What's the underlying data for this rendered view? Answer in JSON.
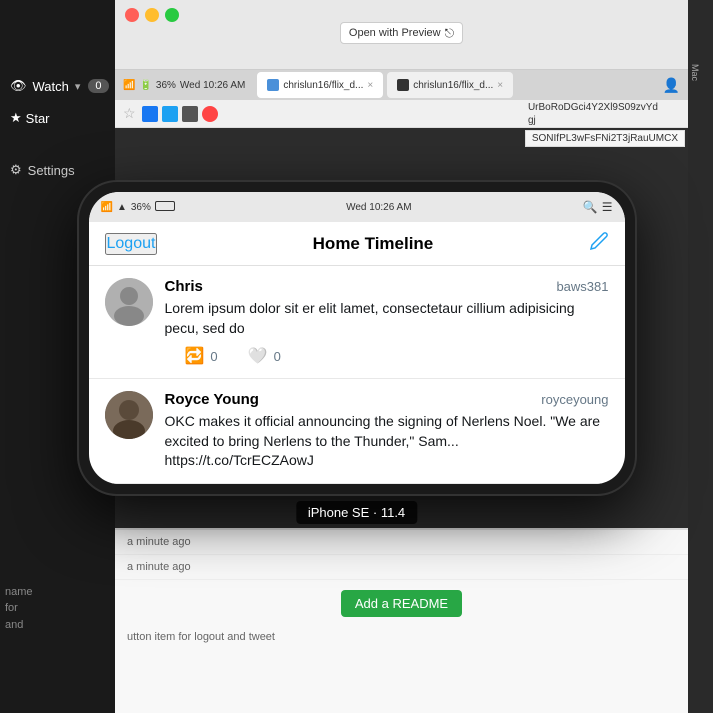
{
  "topBar": {
    "buttons": [
      "red",
      "yellow",
      "green"
    ],
    "openPreview": "Open with Preview"
  },
  "statusBar": {
    "time": "Wed 10:26 AM",
    "batteryPercent": "36%",
    "wifi": "WiFi"
  },
  "tabs": [
    {
      "label": "chrislun16/flix_d...",
      "active": true
    },
    {
      "label": "chrislun16/flix_d...",
      "active": false
    }
  ],
  "app": {
    "header": {
      "logout": "Logout",
      "title": "Home Timeline",
      "editIcon": "✏"
    },
    "tweets": [
      {
        "name": "Chris",
        "handle": "baws381",
        "text": "Lorem ipsum dolor sit er elit lamet, consectetaur cillium adipisicing pecu, sed do",
        "retweets": "0",
        "likes": "0",
        "hasAvatar": false
      },
      {
        "name": "Royce Young",
        "handle": "royceyoung",
        "text": "OKC makes it official announcing the signing of Nerlens Noel. \"We are excited to bring Nerlens to the Thunder,\" Sam... https://t.co/TcrECZAowJ",
        "hasAvatar": true
      }
    ]
  },
  "deviceLabel": "iPhone SE · 11.4",
  "sidebar": {
    "watchLabel": "Watch",
    "watchCount": "0",
    "starLabel": "Star",
    "settingsLabel": "Settings",
    "bottomText": "name\nfor\nand"
  },
  "bottomArea": {
    "timeStamp1": "a minute ago",
    "timeStamp2": "a minute ago",
    "addReadmeBtn": "Add a README",
    "infoText": "utton item for logout and tweet"
  },
  "rightPanel": {
    "text": "Mac"
  },
  "overlay": {
    "text1": "UrBoRoDGci4Y2Xl9S09zvYd",
    "text2": "gj",
    "text3": "SONIfPL3wFsFNi2T3jRauUMCX"
  },
  "searchPlaceholder": "Search"
}
